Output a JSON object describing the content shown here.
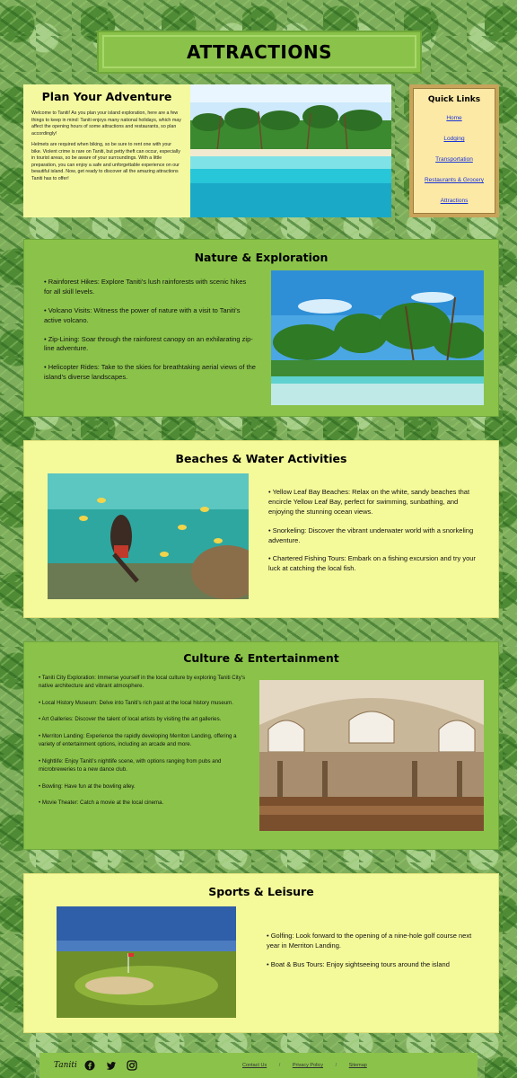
{
  "header": {
    "title": "ATTRACTIONS"
  },
  "intro": {
    "title": "Plan Your Adventure",
    "p1": "Welcome to Taniti! As you plan your island exploration, here are a few things to keep in mind: Taniti enjoys many national holidays, which may affect the opening hours of some attractions and restaurants, so plan accordingly!",
    "p2": "Helmets are required when biking, so be sure to rent one with your bike. Violent crime is rare on Taniti, but petty theft can occur, especially in tourist areas, so be aware of your surroundings. With a little preparation, you can enjoy a safe and unforgettable experience on our beautiful island. Now, get ready to discover all the amazing attractions Taniti has to offer!"
  },
  "quick_links": {
    "title": "Quick Links",
    "items": [
      "Home",
      "Lodging",
      "Transportation",
      "Restaurants & Grocery",
      "Attractions"
    ]
  },
  "nature": {
    "title": "Nature & Exploration",
    "items": [
      "• Rainforest Hikes: Explore Taniti's lush rainforests with scenic hikes for all skill levels.",
      "• Volcano Visits: Witness the power of nature with a visit to Taniti's active volcano.",
      "• Zip-Lining: Soar through the rainforest canopy on an exhilarating zip-line adventure.",
      "• Helicopter Rides: Take to the skies for breathtaking aerial views of the island's diverse landscapes."
    ]
  },
  "beaches": {
    "title": "Beaches & Water Activities",
    "items": [
      "• Yellow Leaf Bay Beaches: Relax on the white, sandy beaches that encircle Yellow Leaf Bay, perfect for swimming, sunbathing, and enjoying the stunning ocean views.",
      "• Snorkeling: Discover the vibrant underwater world with a snorkeling adventure.",
      "• Chartered Fishing Tours: Embark on a fishing excursion and try your luck at catching the local fish."
    ]
  },
  "culture": {
    "title": "Culture & Entertainment",
    "items": [
      "• Taniti City Exploration: Immerse yourself in the local culture by exploring Taniti City's native architecture and vibrant atmosphere.",
      "• Local History Museum: Delve into Taniti's rich past at the local history museum.",
      "• Art Galleries: Discover the talent of local artists by visiting the art galleries.",
      "• Merriton Landing: Experience the rapidly developing Merriton Landing, offering a variety of entertainment options, including an arcade and more.",
      "• Nightlife: Enjoy Taniti's nightlife scene, with options ranging from pubs and microbreweries to a new dance club.",
      "• Bowling: Have fun at the bowling alley.",
      "• Movie Theater: Catch a movie at the local cinema."
    ]
  },
  "sports": {
    "title": "Sports & Leisure",
    "items": [
      "• Golfing: Look forward to the opening of a nine-hole golf course next year in Merriton Landing.",
      "• Boat & Bus Tours: Enjoy sightseeing tours around the island"
    ]
  },
  "footer": {
    "logo": "Taniti",
    "links": [
      "Contact Us",
      "Privacy Policy",
      "Sitemap"
    ],
    "separator": "/",
    "social_icons": [
      "facebook-icon",
      "twitter-icon",
      "instagram-icon"
    ]
  },
  "colors": {
    "section_green": "#8bc34a",
    "section_yellow": "#f4f99a",
    "link_blue": "#1a35d8"
  }
}
